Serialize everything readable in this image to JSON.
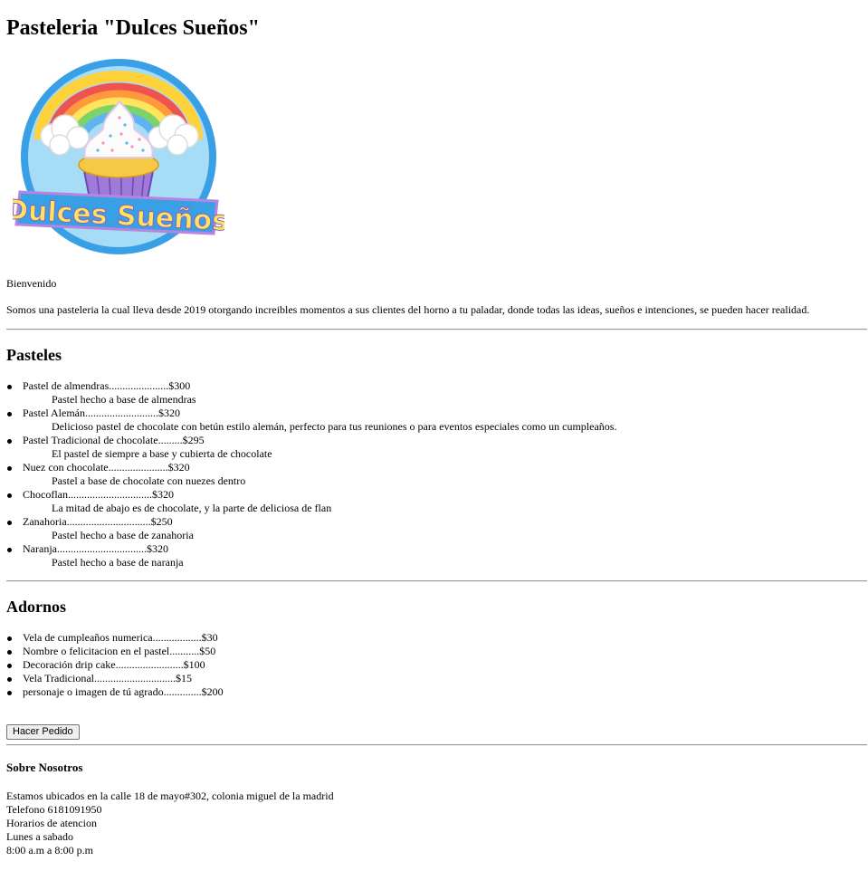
{
  "page": {
    "title": "Pasteleria \"Dulces Sueños\"",
    "logo_text": "Dulces Sueños",
    "welcome": "Bienvenido",
    "intro": "Somos una pasteleria la cual lleva desde 2019 otorgando increibles momentos a sus clientes del horno a tu paladar, donde todas las ideas, sueños e intenciones, se pueden hacer realidad."
  },
  "pasteles": {
    "heading": "Pasteles",
    "items": [
      {
        "label": "Pastel de almendras......................$300",
        "desc": "Pastel hecho a base de almendras"
      },
      {
        "label": "Pastel Alemán...........................$320",
        "desc": "Delicioso pastel de chocolate con betún estilo alemán, perfecto para tus reuniones o para eventos especiales como un cumpleaños."
      },
      {
        "label": "Pastel Tradicional de chocolate.........$295",
        "desc": "El pastel de siempre a base y cubierta de chocolate"
      },
      {
        "label": "Nuez con chocolate......................$320",
        "desc": "Pastel a base de chocolate con nuezes dentro"
      },
      {
        "label": "Chocoflan...............................$320",
        "desc": "La mitad de abajo es de chocolate, y la parte de deliciosa de flan"
      },
      {
        "label": "Zanahoria...............................$250",
        "desc": "Pastel hecho a base de zanahoria"
      },
      {
        "label": "Naranja.................................$320",
        "desc": "Pastel hecho a base de naranja"
      }
    ]
  },
  "adornos": {
    "heading": "Adornos",
    "items": [
      "Vela de cumpleaños numerica..................$30",
      "Nombre o felicitacion en el pastel...........$50",
      "Decoración drip cake.........................$100",
      "Vela Tradicional..............................$15",
      "personaje o imagen de tú agrado..............$200"
    ]
  },
  "order_button": "Hacer Pedido",
  "about": {
    "heading": "Sobre Nosotros",
    "lines": [
      "Estamos ubicados en la calle 18 de mayo#302, colonia miguel de la madrid",
      "Telefono 6181091950",
      "Horarios de atencion",
      "Lunes a sabado",
      "8:00 a.m a 8:00 p.m"
    ]
  }
}
